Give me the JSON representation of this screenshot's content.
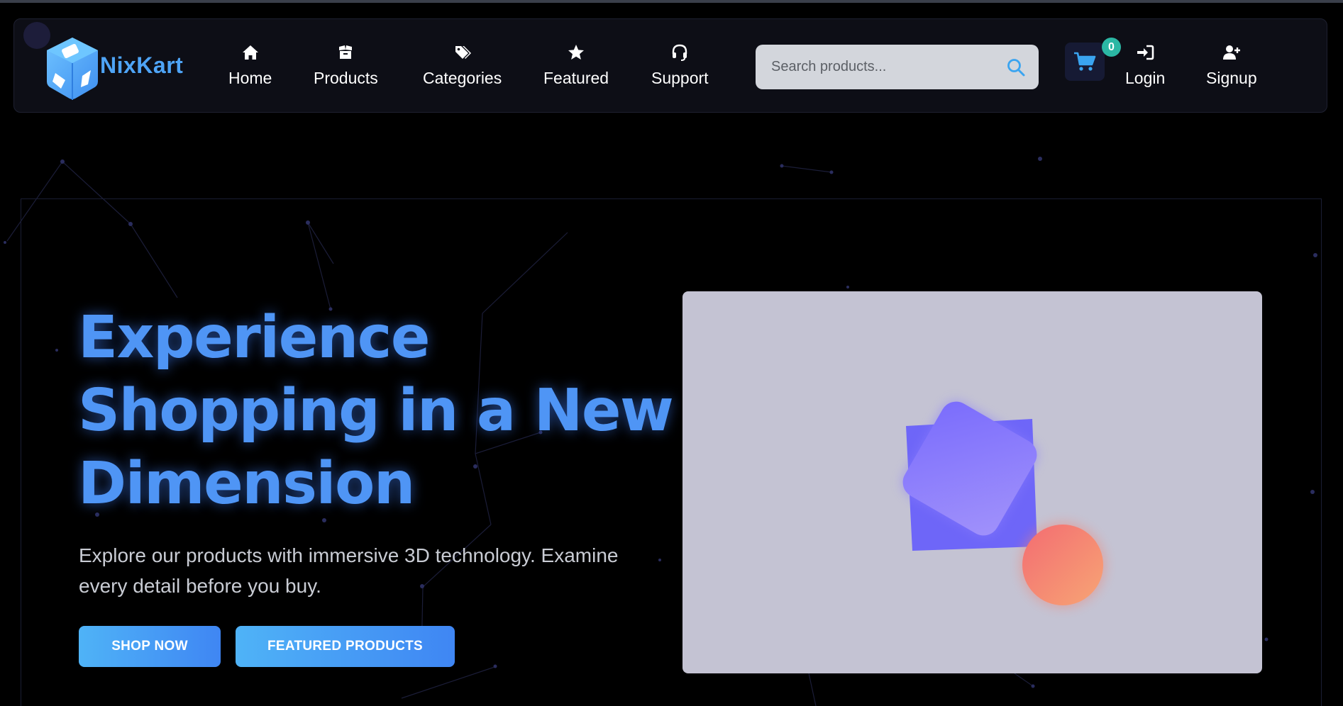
{
  "brand": {
    "name": "NixKart",
    "accent": "#4ea4f6"
  },
  "nav": {
    "items": [
      {
        "label": "Home",
        "icon": "home-icon"
      },
      {
        "label": "Products",
        "icon": "box-icon"
      },
      {
        "label": "Categories",
        "icon": "tags-icon"
      },
      {
        "label": "Featured",
        "icon": "star-icon"
      },
      {
        "label": "Support",
        "icon": "headset-icon"
      }
    ]
  },
  "search": {
    "placeholder": "Search products...",
    "value": "",
    "icon": "search-icon"
  },
  "cart": {
    "count": "0",
    "icon": "cart-icon"
  },
  "auth": {
    "login_label": "Login",
    "login_icon": "sign-in-icon",
    "signup_label": "Signup",
    "signup_icon": "user-plus-icon"
  },
  "hero": {
    "title": "Experience Shopping in a New Dimension",
    "subtitle": "Explore our products with immersive 3D technology. Examine every detail before you buy.",
    "primary_cta": "SHOP NOW",
    "secondary_cta": "FEATURED PRODUCTS",
    "title_color": "#4f95f5",
    "button_gradient": [
      "#4fb3f7",
      "#3f86f3"
    ],
    "visual_background": "#c4c3d3"
  }
}
